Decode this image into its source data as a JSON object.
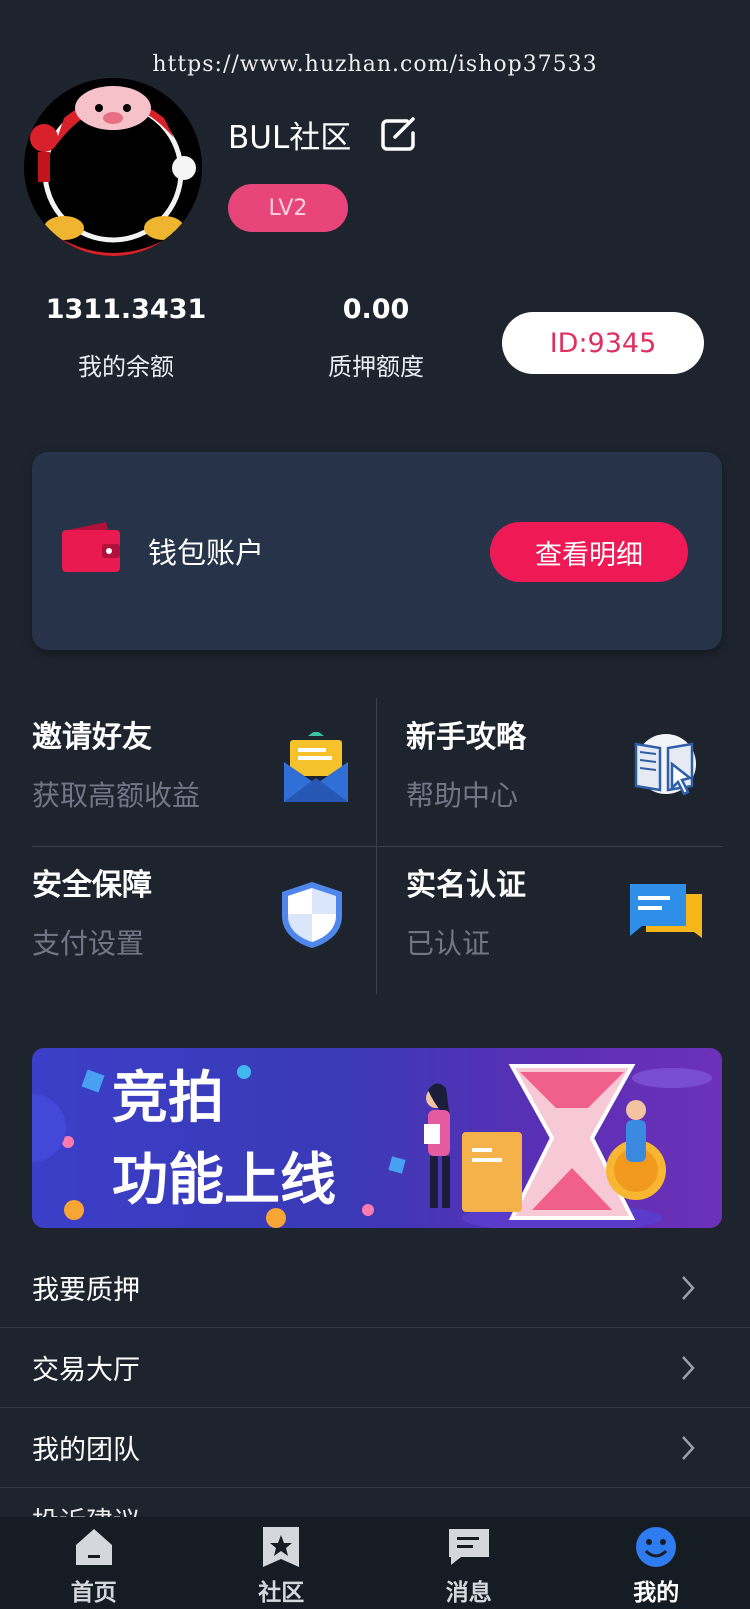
{
  "watermark": "https://www.huzhan.com/ishop37533",
  "profile": {
    "username": "BUL社区",
    "level": "LV2",
    "id_label": "ID:9345"
  },
  "stats": {
    "balance_value": "1311.3431",
    "balance_label": "我的余额",
    "pledge_value": "0.00",
    "pledge_label": "质押额度"
  },
  "wallet": {
    "label": "钱包账户",
    "button": "查看明细"
  },
  "grid": [
    {
      "title": "邀请好友",
      "sub": "获取高额收益",
      "icon": "envelope-icon"
    },
    {
      "title": "新手攻略",
      "sub": "帮助中心",
      "icon": "book-cursor-icon"
    },
    {
      "title": "安全保障",
      "sub": "支付设置",
      "icon": "shield-icon"
    },
    {
      "title": "实名认证",
      "sub": "已认证",
      "icon": "chat-card-icon"
    }
  ],
  "banner": {
    "line1": "竞拍",
    "line2": "功能上线"
  },
  "menu": [
    {
      "label": "我要质押"
    },
    {
      "label": "交易大厅"
    },
    {
      "label": "我的团队"
    }
  ],
  "menu_partial": "投诉建议",
  "tabs": [
    {
      "label": "首页",
      "icon": "home-icon"
    },
    {
      "label": "社区",
      "icon": "star-bookmark-icon"
    },
    {
      "label": "消息",
      "icon": "message-icon"
    },
    {
      "label": "我的",
      "icon": "smiley-icon"
    }
  ],
  "colors": {
    "background": "#1e242e",
    "accent": "#ef1a55",
    "level_badge": "#e8457a",
    "card": "#263348"
  }
}
